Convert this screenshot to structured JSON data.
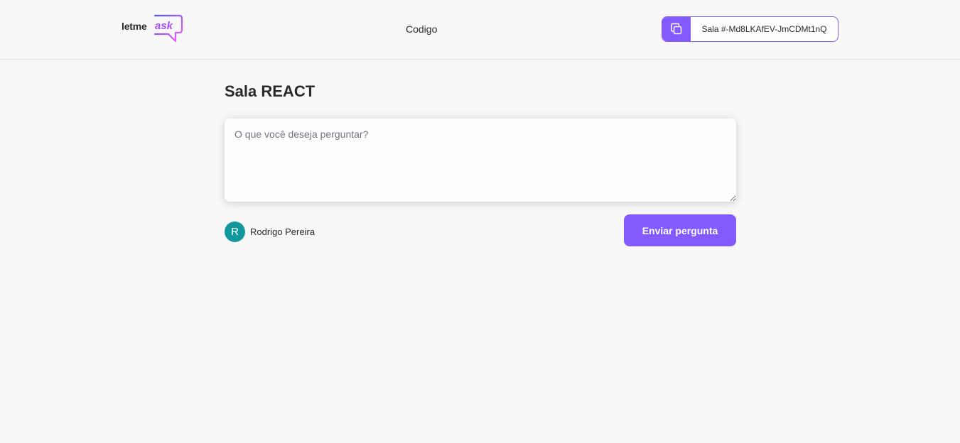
{
  "header": {
    "logo": {
      "text_letme": "letme",
      "text_ask": "ask",
      "icon": "chat-bubble-logo"
    },
    "code_label": "Codigo",
    "room_code": {
      "icon": "copy-icon",
      "text": "Sala #-Md8LKAfEV-JmCDMt1nQ"
    }
  },
  "main": {
    "title": "Sala REACT",
    "question_input": {
      "placeholder": "O que você deseja perguntar?",
      "value": ""
    },
    "user": {
      "avatar_initial": "R",
      "name": "Rodrigo Pereira"
    },
    "send_button_label": "Enviar pergunta"
  },
  "colors": {
    "accent": "#835afd",
    "logo_ask": "#a64dff",
    "avatar": "#12979f",
    "background": "#f8f8f8",
    "text": "#29292e",
    "placeholder": "#737380"
  }
}
